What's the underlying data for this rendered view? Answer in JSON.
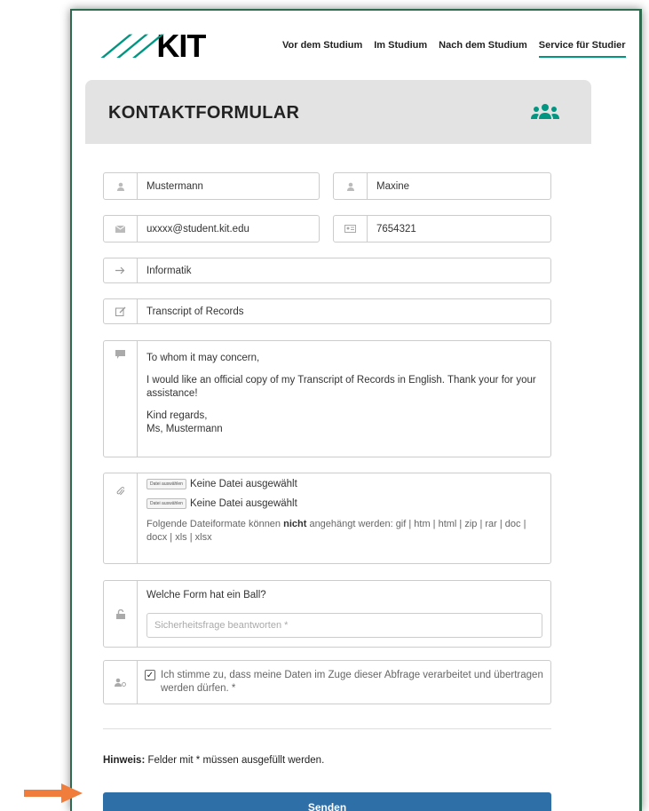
{
  "header": {
    "logo_text": "KIT",
    "nav": [
      "Vor dem Studium",
      "Im Studium",
      "Nach dem Studium",
      "Service für Studier"
    ]
  },
  "hero": {
    "title": "KONTAKTFORMULAR",
    "icon": "users-icon"
  },
  "form": {
    "last_name": "Mustermann",
    "first_name": "Maxine",
    "email": "uxxxx@student.kit.edu",
    "matriculation": "7654321",
    "field_of_study": "Informatik",
    "subject": "Transcript of Records",
    "message": {
      "line1": "To whom it may concern,",
      "line2": "I would like an official copy of my Transcript of Records in English. Thank your for your assistance!",
      "line3": "Kind regards,",
      "line4": "Ms, Mustermann"
    },
    "file_button": "Datei auswählen",
    "file_status": "Keine Datei ausgewählt",
    "file_hint_before": "Folgende Dateiformate können ",
    "file_hint_bold": "nicht",
    "file_hint_after": " angehängt werden: gif | htm | html | zip | rar | doc | docx | xls | xlsx",
    "security_question": "Welche Form hat ein Ball?",
    "security_placeholder": "Sicherheitsfrage beantworten *",
    "consent_text": "Ich stimme zu, dass meine Daten im Zuge dieser Abfrage verarbeitet und übertragen werden dürfen. *",
    "consent_checked": true
  },
  "note": {
    "label": "Hinweis:",
    "text": " Felder mit * müssen ausgefüllt werden."
  },
  "submit_label": "Senden",
  "colors": {
    "brand": "#009682",
    "button": "#2f6fa8",
    "arrow": "#f07d3c"
  }
}
